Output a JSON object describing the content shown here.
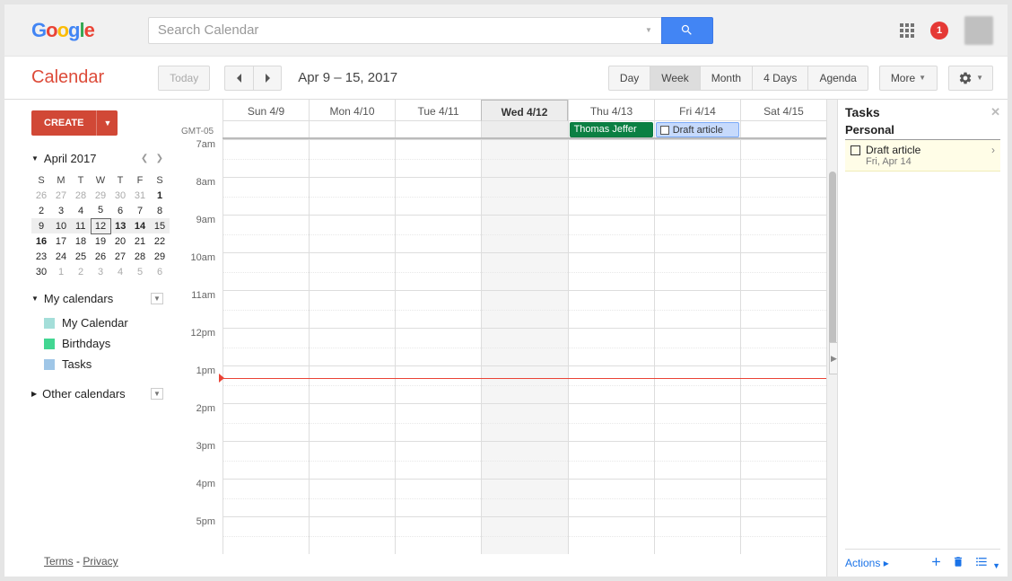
{
  "header": {
    "search_placeholder": "Search Calendar",
    "notif_count": "1"
  },
  "toolbar": {
    "app_title": "Calendar",
    "today": "Today",
    "date_range": "Apr 9 – 15, 2017",
    "views": [
      "Day",
      "Week",
      "Month",
      "4 Days",
      "Agenda"
    ],
    "active_view": "Week",
    "more": "More"
  },
  "sidebar": {
    "create": "CREATE",
    "mini_month": "April 2017",
    "dow": [
      "S",
      "M",
      "T",
      "W",
      "T",
      "F",
      "S"
    ],
    "weeks": [
      [
        {
          "d": "26",
          "dim": true
        },
        {
          "d": "27",
          "dim": true
        },
        {
          "d": "28",
          "dim": true
        },
        {
          "d": "29",
          "dim": true
        },
        {
          "d": "30",
          "dim": true
        },
        {
          "d": "31",
          "dim": true
        },
        {
          "d": "1",
          "bold": true
        }
      ],
      [
        {
          "d": "2"
        },
        {
          "d": "3"
        },
        {
          "d": "4"
        },
        {
          "d": "5"
        },
        {
          "d": "6"
        },
        {
          "d": "7"
        },
        {
          "d": "8"
        }
      ],
      [
        {
          "d": "9"
        },
        {
          "d": "10"
        },
        {
          "d": "11"
        },
        {
          "d": "12",
          "today": true
        },
        {
          "d": "13",
          "bold": true
        },
        {
          "d": "14",
          "bold": true
        },
        {
          "d": "15"
        }
      ],
      [
        {
          "d": "16",
          "bold": true
        },
        {
          "d": "17"
        },
        {
          "d": "18"
        },
        {
          "d": "19"
        },
        {
          "d": "20"
        },
        {
          "d": "21"
        },
        {
          "d": "22"
        }
      ],
      [
        {
          "d": "23"
        },
        {
          "d": "24"
        },
        {
          "d": "25"
        },
        {
          "d": "26"
        },
        {
          "d": "27"
        },
        {
          "d": "28"
        },
        {
          "d": "29"
        }
      ],
      [
        {
          "d": "30"
        },
        {
          "d": "1",
          "dim": true
        },
        {
          "d": "2",
          "dim": true
        },
        {
          "d": "3",
          "dim": true
        },
        {
          "d": "4",
          "dim": true
        },
        {
          "d": "5",
          "dim": true
        },
        {
          "d": "6",
          "dim": true
        }
      ]
    ],
    "my_calendars_label": "My calendars",
    "my_calendars": [
      {
        "name": "My Calendar",
        "color": "#a4ded9"
      },
      {
        "name": "Birthdays",
        "color": "#42d692"
      },
      {
        "name": "Tasks",
        "color": "#9fc6e7"
      }
    ],
    "other_calendars_label": "Other calendars",
    "terms": "Terms",
    "privacy": "Privacy"
  },
  "grid": {
    "tz": "GMT-05",
    "days": [
      {
        "label": "Sun 4/9"
      },
      {
        "label": "Mon 4/10"
      },
      {
        "label": "Tue 4/11"
      },
      {
        "label": "Wed 4/12",
        "today": true
      },
      {
        "label": "Thu 4/13"
      },
      {
        "label": "Fri 4/14"
      },
      {
        "label": "Sat 4/15"
      }
    ],
    "allday_events": [
      {
        "day": 4,
        "title": "Thomas Jeffer",
        "type": "green"
      },
      {
        "day": 5,
        "title": "Draft article",
        "type": "blue"
      }
    ],
    "hours": [
      "7am",
      "8am",
      "9am",
      "10am",
      "11am",
      "12pm",
      "1pm",
      "2pm",
      "3pm",
      "4pm",
      "5pm"
    ]
  },
  "tasks": {
    "title": "Tasks",
    "list": "Personal",
    "items": [
      {
        "name": "Draft article",
        "date": "Fri, Apr 14"
      }
    ],
    "actions": "Actions"
  }
}
